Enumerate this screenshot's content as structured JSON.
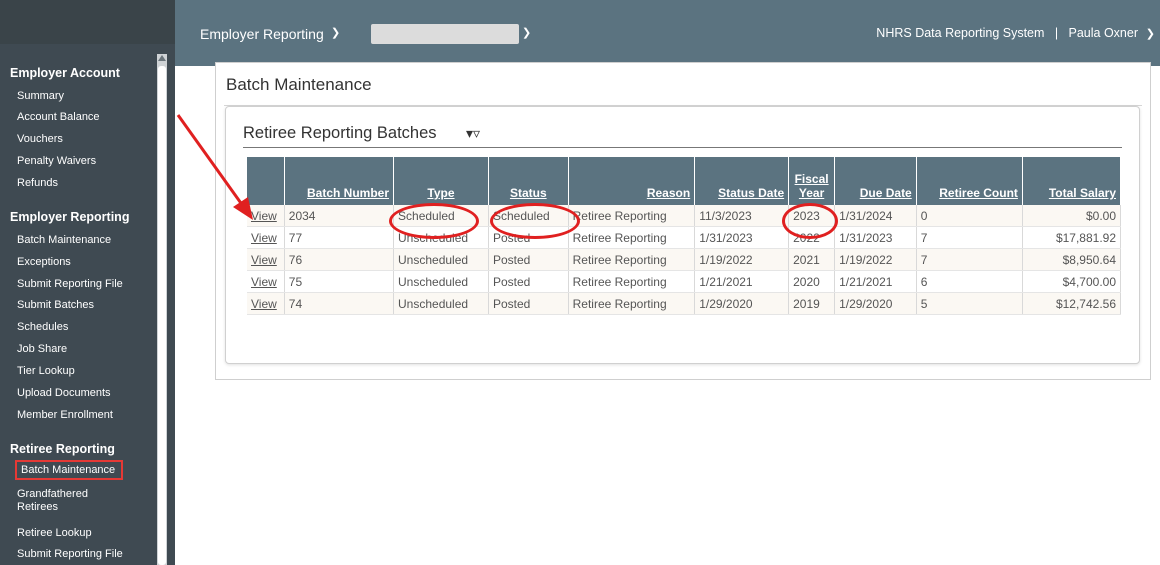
{
  "sidebar": {
    "sections": [
      {
        "title": "Employer Account",
        "items": [
          "Summary",
          "Account Balance",
          "Vouchers",
          "Penalty Waivers",
          "Refunds"
        ]
      },
      {
        "title": "Employer Reporting",
        "items": [
          "Batch Maintenance",
          "Exceptions",
          "Submit Reporting File",
          "Submit Batches",
          "Schedules",
          "Job Share",
          "Tier Lookup",
          "Upload Documents",
          "Member Enrollment"
        ]
      },
      {
        "title": "Retiree Reporting",
        "items": [
          "Batch Maintenance",
          "Grandfathered Retirees",
          "Retiree Lookup",
          "Submit Reporting File"
        ]
      }
    ]
  },
  "topbar": {
    "module_menu": "Employer Reporting",
    "system_name": "NHRS Data Reporting System",
    "separator": "|",
    "user": "Paula Oxner"
  },
  "page": {
    "title": "Batch Maintenance",
    "panel_title": "Retiree Reporting Batches"
  },
  "table": {
    "headers": [
      "Batch Number",
      "Type",
      "Status",
      "Reason",
      "Status Date",
      "Fiscal Year",
      "Due Date",
      "Retiree Count",
      "Total Salary"
    ],
    "link_label": "View",
    "rows": [
      [
        "2034",
        "Scheduled",
        "Scheduled",
        "Retiree Reporting",
        "11/3/2023",
        "2023",
        "1/31/2024",
        "0",
        "$0.00"
      ],
      [
        "77",
        "Unscheduled",
        "Posted",
        "Retiree Reporting",
        "1/31/2023",
        "2022",
        "1/31/2023",
        "7",
        "$17,881.92"
      ],
      [
        "76",
        "Unscheduled",
        "Posted",
        "Retiree Reporting",
        "1/19/2022",
        "2021",
        "1/19/2022",
        "7",
        "$8,950.64"
      ],
      [
        "75",
        "Unscheduled",
        "Posted",
        "Retiree Reporting",
        "1/21/2021",
        "2020",
        "1/21/2021",
        "6",
        "$4,700.00"
      ],
      [
        "74",
        "Unscheduled",
        "Posted",
        "Retiree Reporting",
        "1/29/2020",
        "2019",
        "1/29/2020",
        "5",
        "$12,742.56"
      ]
    ]
  },
  "colors": {
    "header_bg": "#5b7380",
    "sidebar_bg": "#3f4a52",
    "annotation": "#e02020"
  }
}
